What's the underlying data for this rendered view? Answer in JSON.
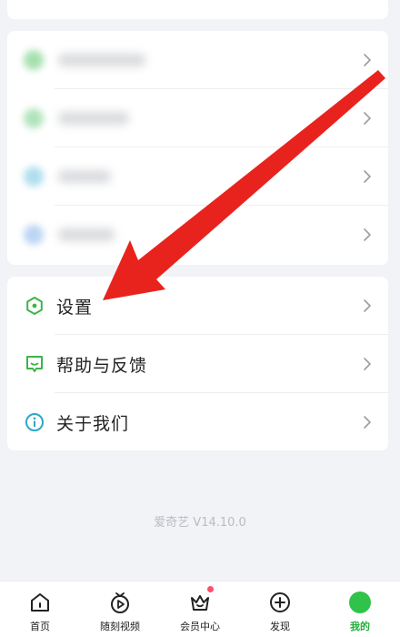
{
  "menu": {
    "items": [
      {
        "label": "设置",
        "icon": "hexagon-settings-icon",
        "color": "#3bb54a"
      },
      {
        "label": "帮助与反馈",
        "icon": "chat-bubble-icon",
        "color": "#3bb54a"
      },
      {
        "label": "关于我们",
        "icon": "info-circle-icon",
        "color": "#2aa7c9"
      }
    ]
  },
  "version": "爱奇艺 V14.10.0",
  "tabbar": {
    "items": [
      {
        "label": "首页",
        "icon": "home-icon"
      },
      {
        "label": "随刻视频",
        "icon": "play-tv-icon"
      },
      {
        "label": "会员中心",
        "icon": "crown-icon",
        "badge": true
      },
      {
        "label": "发现",
        "icon": "plus-circle-icon"
      },
      {
        "label": "我的",
        "icon": "avatar-icon",
        "active": true
      }
    ]
  },
  "colors": {
    "accent": "#1fae3a",
    "arrow": "#e8231e",
    "badge": "#ff4f6a"
  }
}
